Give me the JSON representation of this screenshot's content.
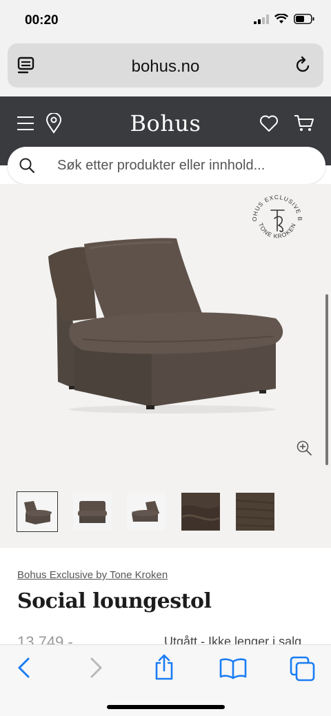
{
  "status": {
    "time": "00:20"
  },
  "browser": {
    "url": "bohus.no"
  },
  "site": {
    "logo": "Bohus",
    "search_placeholder": "Søk etter produkter eller innhold..."
  },
  "badge": {
    "text_top": "BOHUS EXCLUSIVE BY",
    "text_bottom": "TONE KROKEN",
    "monogram": "TK"
  },
  "thumbnails": [
    {
      "name": "front-view",
      "active": true
    },
    {
      "name": "front-straight-view",
      "active": false
    },
    {
      "name": "side-view",
      "active": false
    },
    {
      "name": "fabric-closeup",
      "active": false
    },
    {
      "name": "fabric-texture",
      "active": false
    }
  ],
  "product": {
    "brand": "Bohus Exclusive by Tone Kroken",
    "title": "Social loungestol",
    "price": "13 749,-",
    "availability": "Utgått - Ikke lenger i salg"
  },
  "colors": {
    "header_bg": "#3a3b3f",
    "hero_bg": "#f3f2f1",
    "ios_blue": "#1a7cf5",
    "chair": "#5a4e47"
  },
  "icons": [
    "menu-icon",
    "location-icon",
    "heart-icon",
    "cart-icon",
    "search-icon",
    "zoom-in-icon",
    "back-icon",
    "forward-icon",
    "share-icon",
    "bookmarks-icon",
    "tabs-icon",
    "reload-icon",
    "reader-icon"
  ]
}
